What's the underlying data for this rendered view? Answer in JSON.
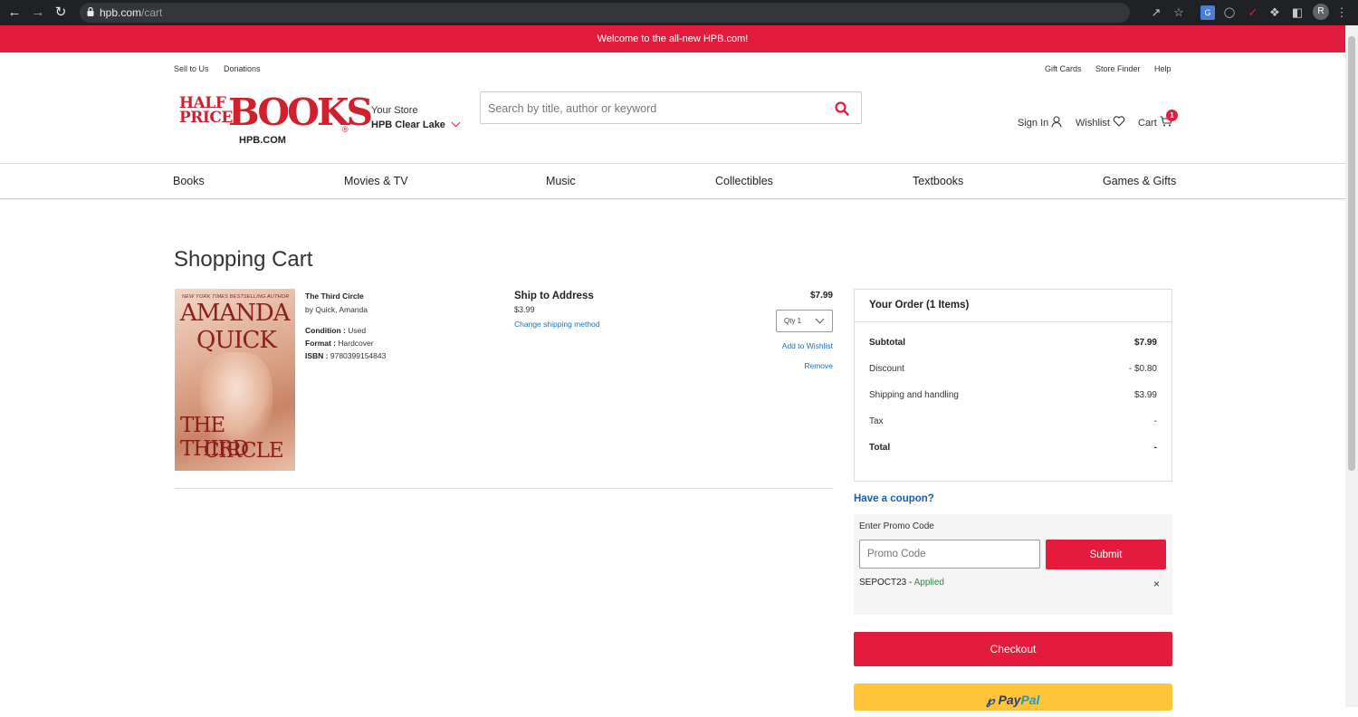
{
  "browser": {
    "url_host": "hpb.com",
    "url_path": "/cart",
    "profile_initial": "R"
  },
  "promo_bar": "Welcome to the all-new HPB.com!",
  "utility_left": [
    "Sell to Us",
    "Donations"
  ],
  "utility_right": [
    "Gift Cards",
    "Store Finder",
    "Help"
  ],
  "logo": {
    "line1": "HALF",
    "line2": "PRICE",
    "books": "BOOKS",
    "domain": "HPB.COM"
  },
  "store": {
    "label": "Your Store",
    "name": "HPB Clear Lake"
  },
  "search": {
    "placeholder": "Search by title, author or keyword"
  },
  "header_links": {
    "sign_in": "Sign In",
    "wishlist": "Wishlist",
    "cart": "Cart",
    "cart_count": "1"
  },
  "nav": [
    "Books",
    "Movies & TV",
    "Music",
    "Collectibles",
    "Textbooks",
    "Games & Gifts"
  ],
  "page_title": "Shopping Cart",
  "item": {
    "cover": {
      "tagline": "NEW YORK TIMES BESTSELLING AUTHOR",
      "author1": "AMANDA",
      "author2": "QUICK",
      "title1": "THE THIRD",
      "title2": "CIRCLE"
    },
    "title": "The Third Circle",
    "author": "by Quick, Amanda",
    "condition_label": "Condition :",
    "condition": "Used",
    "format_label": "Format :",
    "format": "Hardcover",
    "isbn_label": "ISBN :",
    "isbn": "9780399154843",
    "ship_heading": "Ship to Address",
    "ship_cost": "$3.99",
    "change_shipping": "Change shipping method",
    "price": "$7.99",
    "qty": "Qty 1",
    "add_to_wishlist": "Add to Wishlist",
    "remove": "Remove"
  },
  "summary": {
    "heading": "Your Order (1 Items)",
    "subtotal_label": "Subtotal",
    "subtotal": "$7.99",
    "discount_label": "Discount",
    "discount": "- $0.80",
    "shipping_label": "Shipping and handling",
    "shipping": "$3.99",
    "tax_label": "Tax",
    "tax": "-",
    "total_label": "Total",
    "total": "-"
  },
  "coupon": {
    "link": "Have a coupon?",
    "label": "Enter Promo Code",
    "placeholder": "Promo Code",
    "submit": "Submit",
    "code": "SEPOCT23",
    "separator": " - ",
    "status": "Applied",
    "remove_symbol": "×"
  },
  "checkout": "Checkout",
  "paypal": {
    "pay": "Pay",
    "pal": "Pal"
  },
  "colors": {
    "brand_red": "#e31c3d",
    "link_blue": "#1a73b8",
    "applied_green": "#2e8b3e",
    "paypal_yellow": "#ffc439"
  }
}
